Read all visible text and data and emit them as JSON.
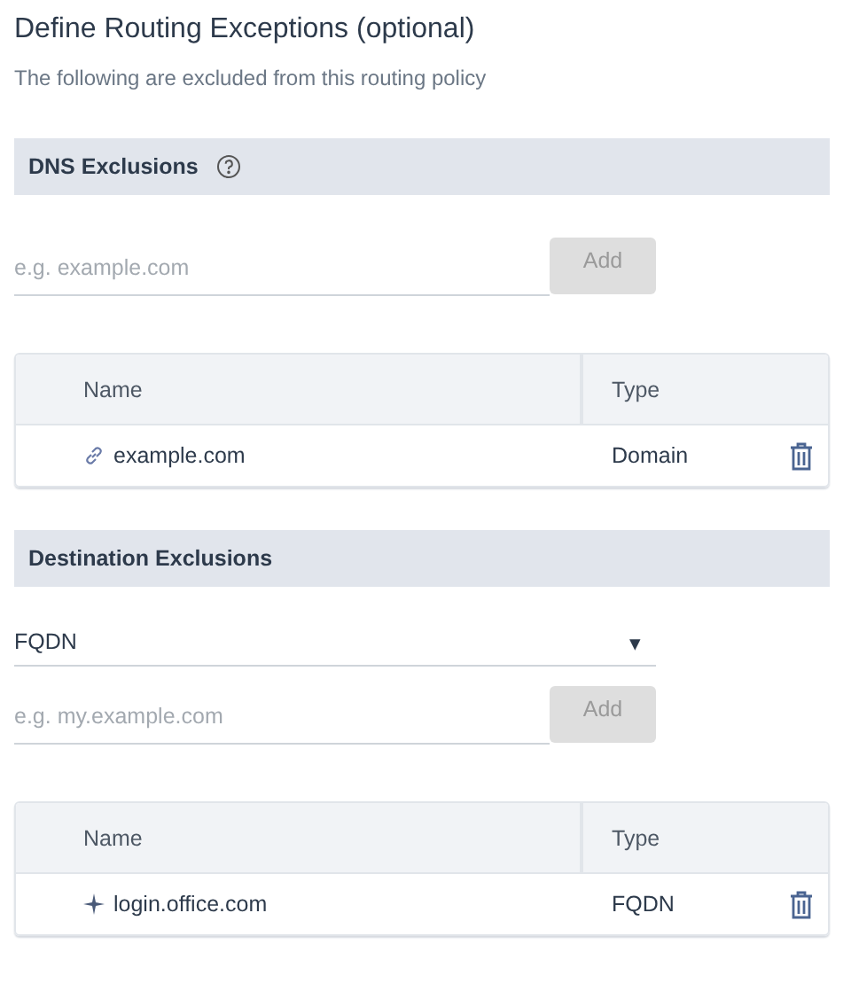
{
  "title": "Define Routing Exceptions (optional)",
  "subtitle": "The following are excluded from this routing policy",
  "sections": [
    {
      "heading": "DNS Exclusions",
      "help": true,
      "input": {
        "placeholder": "e.g. example.com"
      },
      "add_button": {
        "label": "Add",
        "disabled": true
      },
      "table": {
        "columns": [
          "Name",
          "Type"
        ],
        "rows": [
          {
            "kind": "domain",
            "name": "example.com",
            "type": "Domain"
          }
        ]
      }
    },
    {
      "heading": "Destination Exclusions",
      "help": false,
      "select": {
        "value": "FQDN",
        "arrow": "▾"
      },
      "input": {
        "placeholder": "e.g. my.example.com"
      },
      "add_button": {
        "label": "Add",
        "disabled": true
      },
      "table": {
        "columns": [
          "Name",
          "Type"
        ],
        "rows": [
          {
            "kind": "fqdn",
            "name": "login.office.com",
            "type": "FQDN"
          }
        ]
      }
    }
  ]
}
